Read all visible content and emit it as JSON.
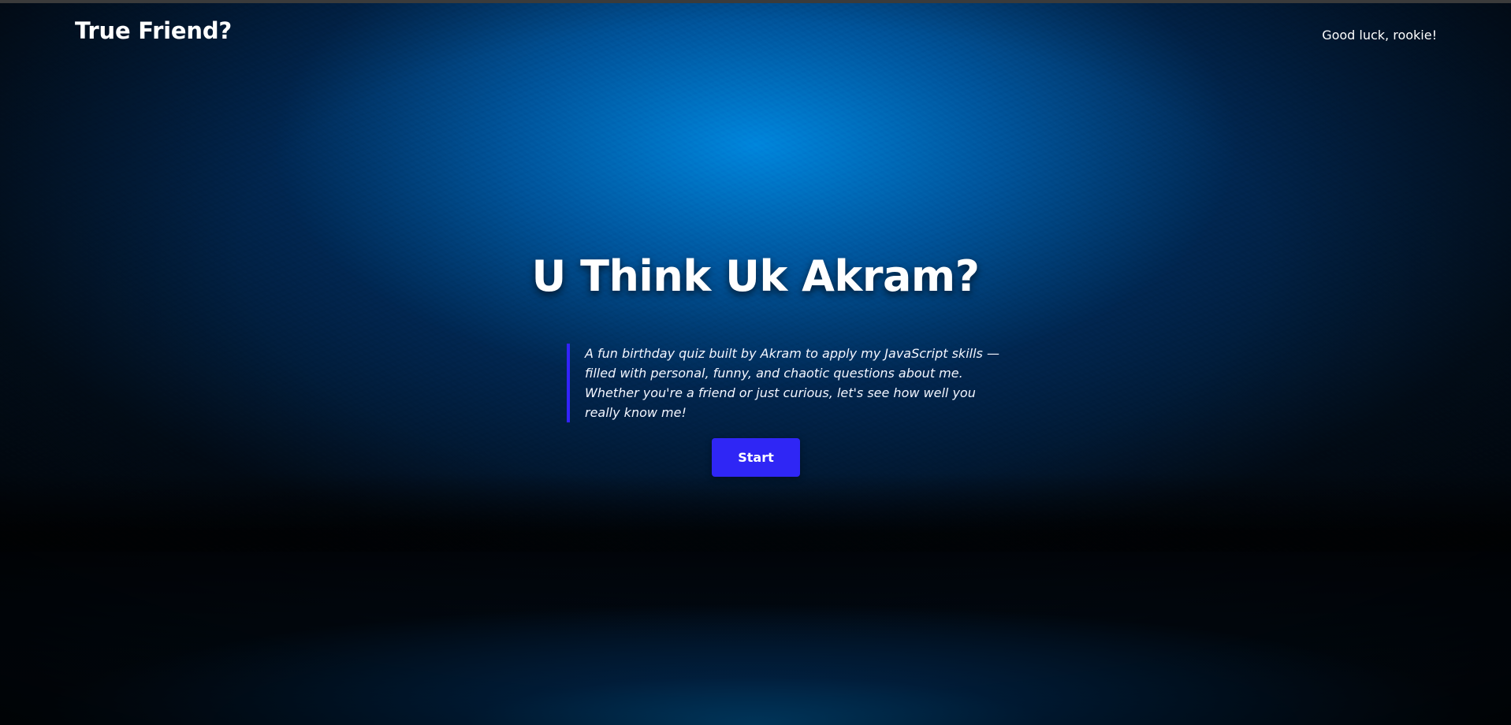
{
  "navbar": {
    "brand": "True Friend?",
    "note": "Good luck, rookie!"
  },
  "hero": {
    "title": "U Think Uk Akram?",
    "description": "A fun birthday quiz built by Akram to apply my JavaScript skills — filled with personal, funny, and chaotic questions about me. Whether you're a friend or just curious, let's see how well you really know me!",
    "start_label": "Start"
  },
  "colors": {
    "accent": "#2f26f5",
    "quote_bar": "#3323ff",
    "background_glow": "#0087e0",
    "text": "#ffffff"
  }
}
